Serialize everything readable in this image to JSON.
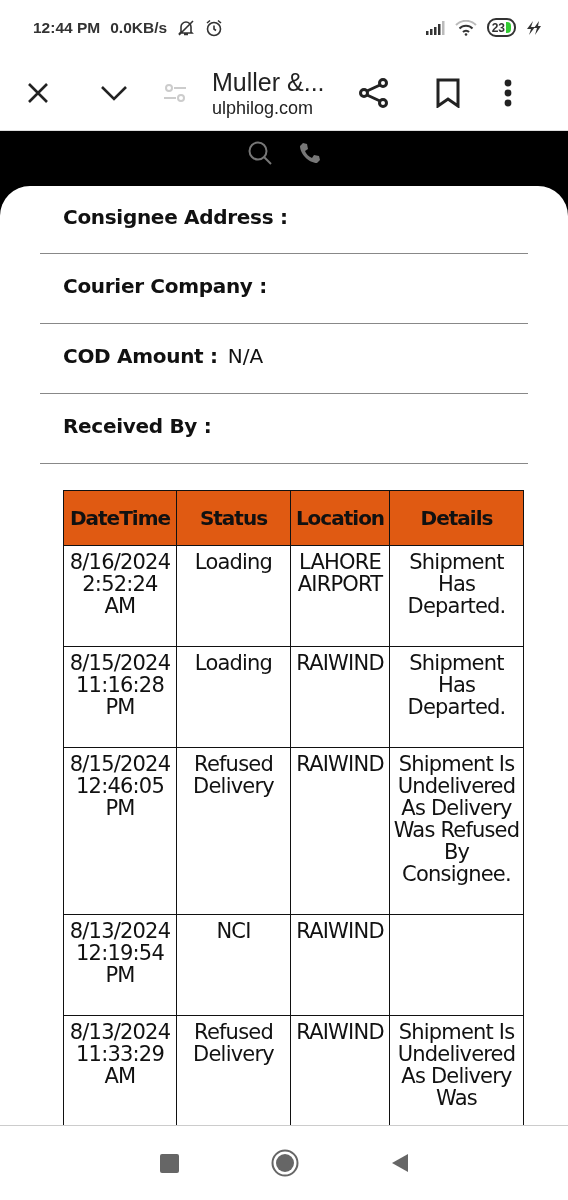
{
  "status_bar": {
    "time": "12:44 PM",
    "speed": "0.0KB/s",
    "battery": "23"
  },
  "browser_toolbar": {
    "title": "Muller &...",
    "url": "ulphilog.com"
  },
  "fields": [
    {
      "label": "Consignee Address :"
    },
    {
      "label": "Courier Company :"
    },
    {
      "label": "COD Amount :",
      "value": "N/A"
    },
    {
      "label": "Received By :"
    }
  ],
  "table": {
    "columns": [
      "DateTime",
      "Status",
      "Location",
      "Details"
    ],
    "rows": [
      [
        "8/16/2024 2:52:24 AM",
        "Loading",
        "LAHORE AIRPORT",
        "Shipment Has Departed."
      ],
      [
        "8/15/2024 11:16:28 PM",
        "Loading",
        "RAIWIND",
        "Shipment Has Departed."
      ],
      [
        "8/15/2024 12:46:05 PM",
        "Refused Delivery",
        "RAIWIND",
        "Shipment Is Undelivered As Delivery Was Refused By Consignee."
      ],
      [
        "8/13/2024 12:19:54 PM",
        "NCI",
        "RAIWIND",
        null
      ],
      [
        "8/13/2024 11:33:29 AM",
        "Refused Delivery",
        "RAIWIND",
        "Shipment Is Undelivered As Delivery Was"
      ]
    ]
  }
}
